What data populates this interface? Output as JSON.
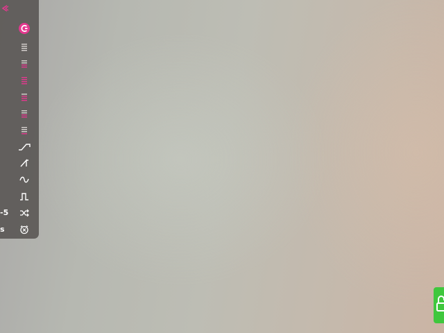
{
  "panel": {
    "top_item": {
      "icon": "collapse-chevron-icon"
    },
    "header_item": {
      "icon": "brand-swirl-icon",
      "color": "#e4388f"
    },
    "tracks": [
      {
        "icon": "track-list-icon-1"
      },
      {
        "icon": "track-list-icon-2"
      },
      {
        "icon": "track-list-icon-3"
      },
      {
        "icon": "track-list-icon-4"
      },
      {
        "icon": "track-list-icon-5"
      },
      {
        "icon": "track-list-icon-6"
      }
    ],
    "waveforms": [
      {
        "icon": "ramp-up-wave-icon",
        "label": ""
      },
      {
        "icon": "sawtooth-wave-icon",
        "label": ""
      },
      {
        "icon": "sine-wave-icon",
        "label": ""
      },
      {
        "icon": "square-wave-icon",
        "label": ""
      },
      {
        "icon": "random-wave-icon",
        "label": "-5"
      },
      {
        "icon": "alarm-clock-icon",
        "label": "s"
      }
    ],
    "accent_color": "#e4388f",
    "background_color": "#585452"
  },
  "lock": {
    "icon": "unlocked-padlock-icon",
    "color": "#3fc73d"
  }
}
